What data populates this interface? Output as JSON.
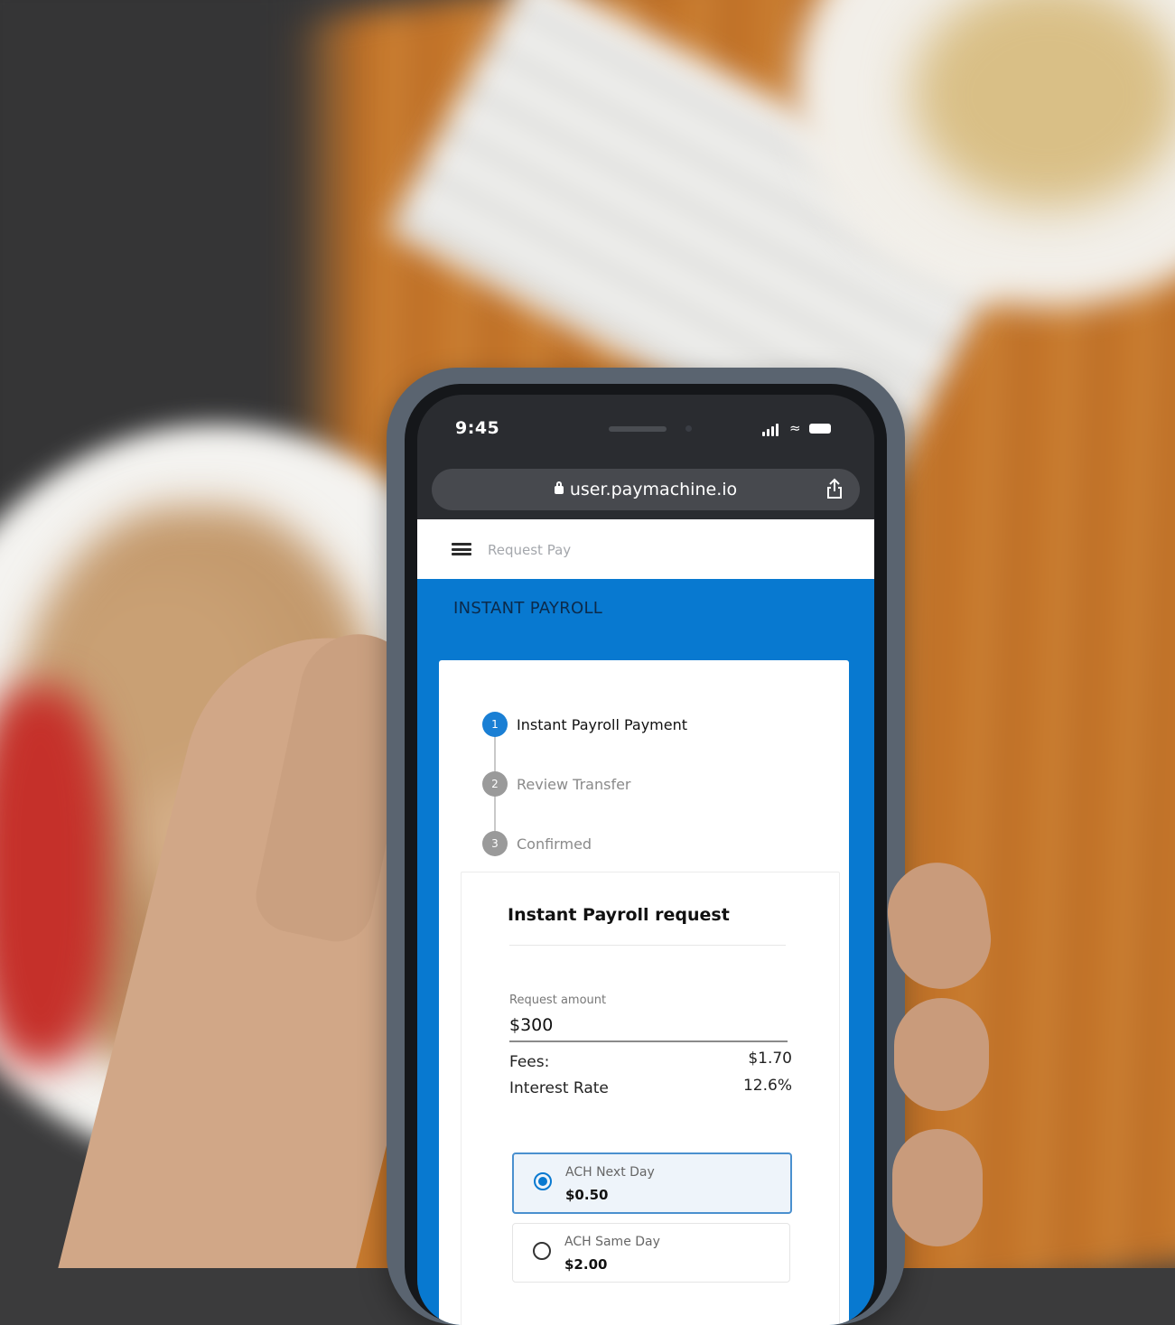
{
  "browser": {
    "time": "9:45",
    "url": "user.paymachine.io"
  },
  "header": {
    "title": "Request Pay"
  },
  "banner": {
    "title": "INSTANT PAYROLL"
  },
  "steps": [
    {
      "number": "1",
      "label": "Instant Payroll Payment",
      "state": "active"
    },
    {
      "number": "2",
      "label": "Review Transfer",
      "state": "inactive"
    },
    {
      "number": "3",
      "label": "Confirmed",
      "state": "inactive"
    }
  ],
  "request": {
    "title": "Instant Payroll request",
    "amount_label": "Request amount",
    "amount_value": "$300",
    "fees_label": "Fees:",
    "fees_value": "$1.70",
    "interest_label": "Interest Rate",
    "interest_value": "12.6%"
  },
  "options": [
    {
      "label": "ACH Next Day",
      "price": "$0.50",
      "selected": true
    },
    {
      "label": "ACH Same Day",
      "price": "$2.00",
      "selected": false
    }
  ],
  "colors": {
    "brand_blue": "#0879d0",
    "step_active": "#1a7fd4",
    "step_inactive": "#9a9a9a",
    "banner_text": "#0c2a4a"
  }
}
